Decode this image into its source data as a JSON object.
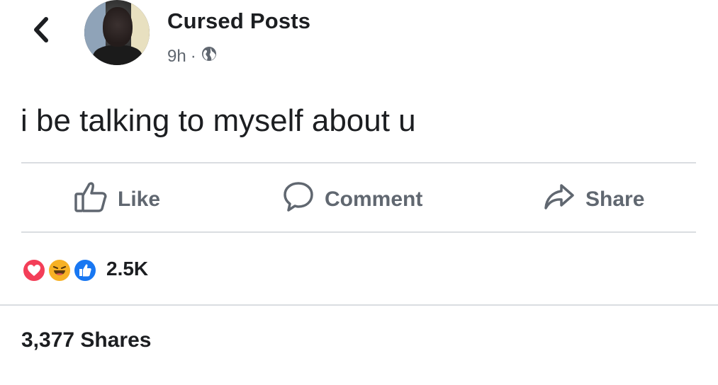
{
  "post": {
    "author": "Cursed Posts",
    "time": "9h",
    "separator": "·",
    "privacy_icon": "globe-icon",
    "text": "i be talking to myself about u"
  },
  "actions": {
    "like_label": "Like",
    "comment_label": "Comment",
    "share_label": "Share"
  },
  "reactions": {
    "types": [
      "love",
      "haha",
      "like"
    ],
    "count": "2.5K"
  },
  "shares": {
    "text": "3,377 Shares"
  },
  "watermark": "",
  "colors": {
    "text": "#1c1e21",
    "secondary_text": "#606770",
    "divider": "#dadde1",
    "love": "#f33e58",
    "haha": "#f7b125",
    "like": "#1877f2"
  }
}
